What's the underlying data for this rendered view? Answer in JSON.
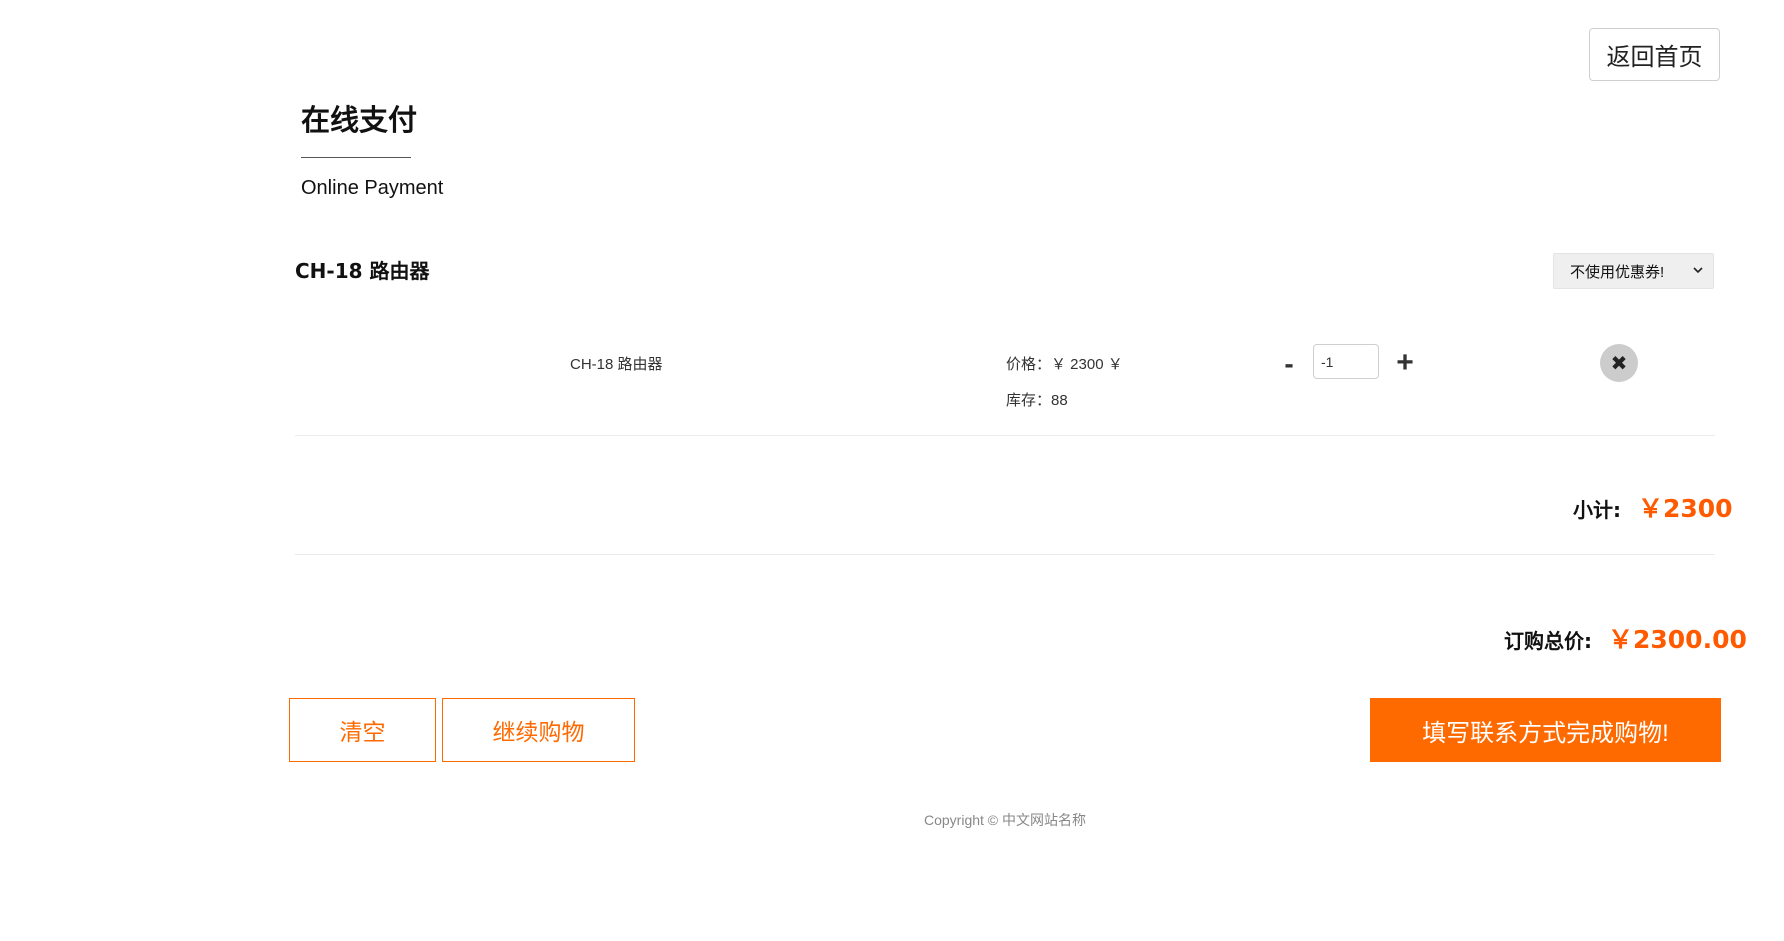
{
  "header": {
    "back_home_label": "返回首页",
    "title": "在线支付",
    "subtitle": "Online Payment"
  },
  "cart": {
    "product_heading": "CH-18 路由器",
    "coupon": {
      "selected": "不使用优惠券!",
      "icon": "chevron-down-icon"
    },
    "items": [
      {
        "name": "CH-18 路由器",
        "price_text": "价格：￥ 2300 ￥",
        "stock_text": "库存：88",
        "minus_label": "-",
        "quantity": "-1",
        "plus_label": "+",
        "remove_icon": "✖"
      }
    ],
    "subtotal_label": "小计:",
    "subtotal_value": "￥2300",
    "total_label": "订购总价:",
    "total_value": "￥2300.00"
  },
  "actions": {
    "clear_label": "清空",
    "continue_label": "继续购物",
    "checkout_label": "填写联系方式完成购物!"
  },
  "footer": {
    "copyright": "Copyright © 中文网站名称"
  },
  "colors": {
    "accent": "#ff6a00",
    "price": "#ff5a00"
  }
}
